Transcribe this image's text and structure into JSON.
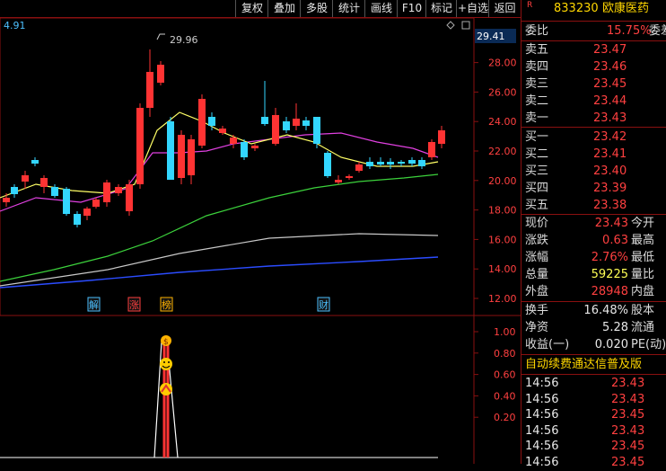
{
  "toolbar": {
    "buttons": [
      "复权",
      "叠加",
      "多股",
      "统计",
      "画线",
      "F10",
      "标记",
      "+自选",
      "返回"
    ],
    "diamond_icon": "diamond-icon",
    "box_icon": "square-icon"
  },
  "main_chart": {
    "top_left_value": "4.91",
    "high_label": "29.96",
    "price_tag": "29.41",
    "y_ticks": [
      "28.00",
      "26.00",
      "24.00",
      "22.00",
      "20.00",
      "18.00",
      "16.00",
      "14.00",
      "12.00"
    ],
    "markers": [
      {
        "text": "解",
        "color": "#4cc0ff"
      },
      {
        "text": "涨",
        "color": "#ff4040"
      },
      {
        "text": "榜",
        "color": "#ffb300"
      },
      {
        "text": "财",
        "color": "#4cc0ff"
      }
    ]
  },
  "sub_chart": {
    "y_ticks": [
      "1.00",
      "0.80",
      "0.60",
      "0.40",
      "0.20"
    ],
    "icons": [
      "money-bag-icon",
      "smiley-icon",
      "peak-icon"
    ]
  },
  "quote": {
    "flag": "R",
    "code": "833230",
    "name": "欧康医药",
    "wei_bi_label": "委比",
    "wei_bi_value": "15.75%",
    "wei_cha_label": "委差",
    "sell": [
      {
        "label": "卖五",
        "price": "23.47"
      },
      {
        "label": "卖四",
        "price": "23.46"
      },
      {
        "label": "卖三",
        "price": "23.45"
      },
      {
        "label": "卖二",
        "price": "23.44"
      },
      {
        "label": "卖一",
        "price": "23.43"
      }
    ],
    "buy": [
      {
        "label": "买一",
        "price": "23.42"
      },
      {
        "label": "买二",
        "price": "23.41"
      },
      {
        "label": "买三",
        "price": "23.40"
      },
      {
        "label": "买四",
        "price": "23.39"
      },
      {
        "label": "买五",
        "price": "23.38"
      }
    ],
    "stats": [
      {
        "label": "现价",
        "value": "23.43",
        "label2": "今开",
        "color": "#ff4040"
      },
      {
        "label": "涨跌",
        "value": "0.63",
        "label2": "最高",
        "color": "#ff4040"
      },
      {
        "label": "涨幅",
        "value": "2.76%",
        "label2": "最低",
        "color": "#ff4040"
      },
      {
        "label": "总量",
        "value": "59225",
        "label2": "量比",
        "color": "#ffff55"
      },
      {
        "label": "外盘",
        "value": "28948",
        "label2": "内盘",
        "color": "#ff4040"
      }
    ],
    "stats2": [
      {
        "label": "换手",
        "value": "16.48%",
        "label2": "股本"
      },
      {
        "label": "净资",
        "value": "5.28",
        "label2": "流通"
      },
      {
        "label": "收益(一)",
        "value": "0.020",
        "label2": "PE(动)"
      }
    ],
    "banner": "自动续费通达信普及版",
    "ticks": [
      {
        "time": "14:56",
        "price": "23.43"
      },
      {
        "time": "14:56",
        "price": "23.43"
      },
      {
        "time": "14:56",
        "price": "23.45"
      },
      {
        "time": "14:56",
        "price": "23.43"
      },
      {
        "time": "14:56",
        "price": "23.45"
      },
      {
        "time": "14:56",
        "price": "23.45"
      }
    ]
  }
}
